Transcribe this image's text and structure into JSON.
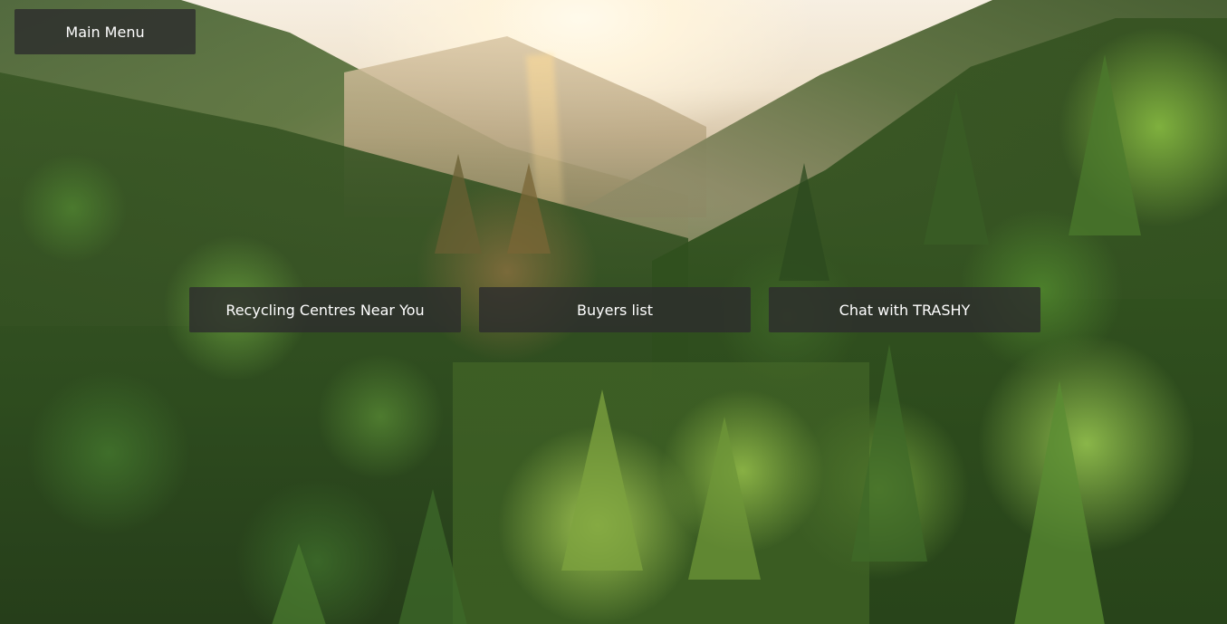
{
  "menu": {
    "main_menu_label": "Main Menu"
  },
  "actions": {
    "recycling_label": "Recycling Centres Near You",
    "buyers_label": "Buyers list",
    "chat_label": "Chat with TRASHY"
  },
  "background": {
    "image": "forest-valley-scene"
  },
  "colors": {
    "button_bg": "#2d2d2d",
    "button_text": "#ffffff"
  }
}
